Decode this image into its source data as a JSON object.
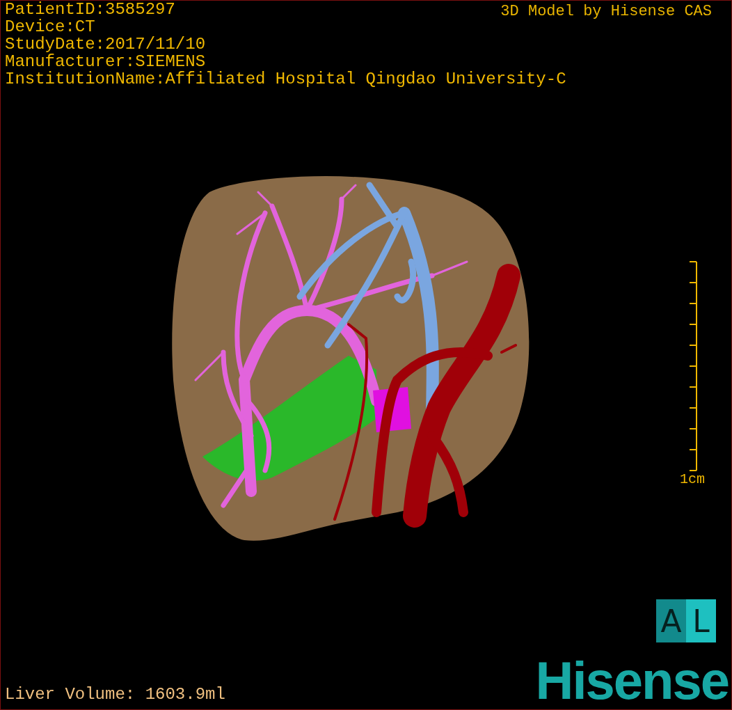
{
  "info_lines": [
    "PatientID:3585297",
    "Device:CT",
    "StudyDate:2017/11/10",
    "Manufacturer:SIEMENS",
    "InstitutionName:Affiliated Hospital Qingdao University-C"
  ],
  "title": "3D Model by Hisense CAS",
  "scale_bar": {
    "label": "1cm"
  },
  "orientation_box": {
    "letters": [
      "A",
      "L"
    ]
  },
  "volume": "Liver Volume: 1603.9ml",
  "logo": "Hisense"
}
